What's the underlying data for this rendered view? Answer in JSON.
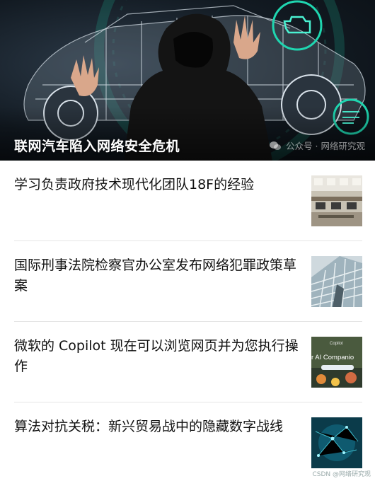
{
  "hero": {
    "title": "联网汽车陷入网络安全危机",
    "watermark": "公众号 · 网络研究观"
  },
  "articles": [
    {
      "title": "学习负责政府技术现代化团队18F的经验",
      "thumb_icon": "office-photo"
    },
    {
      "title": "国际刑事法院检察官办公室发布网络犯罪政策草案",
      "thumb_icon": "glass-building-photo"
    },
    {
      "title": "微软的 Copilot 现在可以浏览网页并为您执行操作",
      "thumb_icon": "copilot-screenshot",
      "thumb_text": "r AI Companio",
      "thumb_brand": "Copilot"
    },
    {
      "title": "算法对抗关税：新兴贸易战中的隐藏数字战线",
      "thumb_icon": "digital-network-image"
    }
  ],
  "footer": {
    "watermark": "CSDN @网络研究观"
  },
  "colors": {
    "accent": "#1fd6b0",
    "divider": "#e5e5e5",
    "text": "#111111"
  }
}
